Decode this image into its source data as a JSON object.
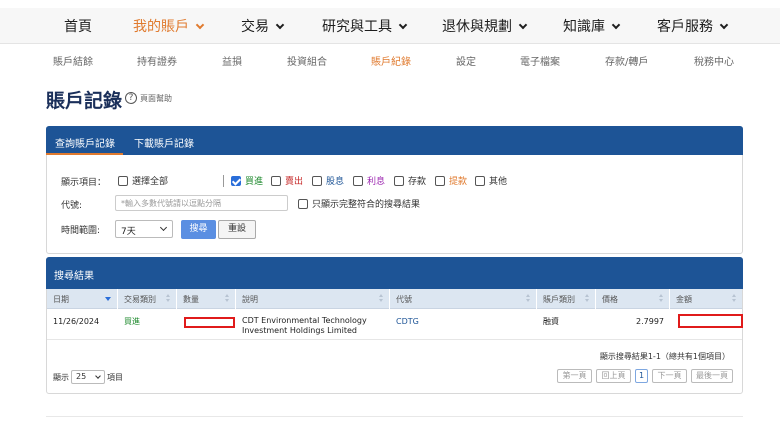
{
  "main_nav": {
    "items": [
      {
        "label": "首頁"
      },
      {
        "label": "我的賬戶"
      },
      {
        "label": "交易"
      },
      {
        "label": "研究與工具"
      },
      {
        "label": "退休與規劃"
      },
      {
        "label": "知識庫"
      },
      {
        "label": "客戶服務"
      }
    ],
    "active_index": 1,
    "active_color": "#e07a2e"
  },
  "sub_nav": {
    "items": [
      {
        "label": "賬戶結餘"
      },
      {
        "label": "持有證券"
      },
      {
        "label": "益損"
      },
      {
        "label": "投資組合"
      },
      {
        "label": "賬戶紀錄"
      },
      {
        "label": "設定"
      },
      {
        "label": "電子檔案"
      },
      {
        "label": "存款/轉戶"
      },
      {
        "label": "稅務中心"
      }
    ],
    "active_index": 4
  },
  "page": {
    "title": "賬戶記錄",
    "help_label": "頁面幫助"
  },
  "query_panel": {
    "tabs": [
      {
        "label": "查詢賬戶記錄"
      },
      {
        "label": "下載賬戶記錄"
      }
    ],
    "active_tab": 0,
    "header_color": "#1d5496",
    "display_items_label": "顯示項目：",
    "checkboxes": [
      {
        "label": "選擇全部",
        "checked": false,
        "color": "#333333"
      },
      {
        "label": "買進",
        "checked": true,
        "color": "#1e8a2d"
      },
      {
        "label": "賣出",
        "checked": false,
        "color": "#c62828"
      },
      {
        "label": "股息",
        "checked": false,
        "color": "#1d5496"
      },
      {
        "label": "利息",
        "checked": false,
        "color": "#9c27b0"
      },
      {
        "label": "存款",
        "checked": false,
        "color": "#333333"
      },
      {
        "label": "提款",
        "checked": false,
        "color": "#e07a2e"
      },
      {
        "label": "其他",
        "checked": false,
        "color": "#333333"
      }
    ],
    "symbol_label": "代號:",
    "symbol_placeholder": "*輸入多數代號請以逗點分隔",
    "exact_match_label": "只顯示完整符合的搜尋結果",
    "exact_match_checked": false,
    "time_range_label": "時間範圍:",
    "time_range_value": "7天",
    "search_label": "搜尋",
    "reset_label": "重設"
  },
  "results": {
    "title": "搜尋結果",
    "columns": [
      "日期",
      "交易類別",
      "數量",
      "說明",
      "代號",
      "賬戶類別",
      "價格",
      "金額"
    ],
    "rows": [
      {
        "date": "11/26/2024",
        "type": "買進",
        "description_line1": "CDT Environmental Technology",
        "description_line2": "Investment Holdings Limited",
        "symbol": "CDTG",
        "account_type": "融資",
        "price": "2.7997"
      }
    ],
    "summary": "顯示搜尋結果1-1（總共有1個項目）",
    "page_size_prefix": "顯示",
    "page_size_value": "25",
    "page_size_suffix": "項目",
    "pager": {
      "first": "第一頁",
      "prev": "回上頁",
      "current": "1",
      "next": "下一頁",
      "last": "最後一頁"
    }
  }
}
